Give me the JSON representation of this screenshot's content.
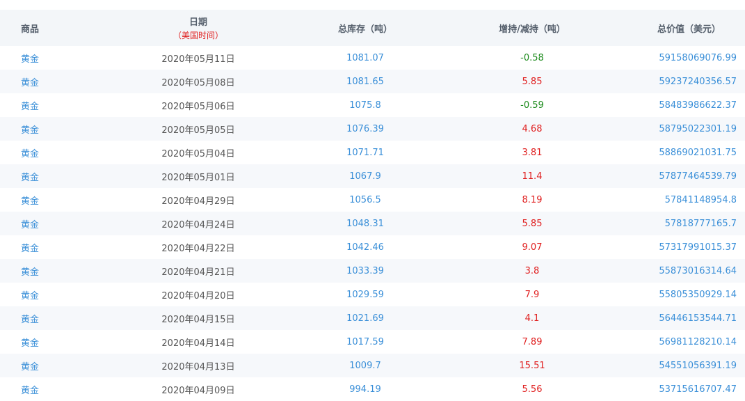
{
  "header": {
    "commodity": "商品",
    "date": "日期",
    "date_note": "（美国时间）",
    "total_holdings": "总库存（吨）",
    "change": "增持/减持（吨）",
    "total_value": "总价值（美元）"
  },
  "colors": {
    "link": "#3a8fd8",
    "increase": "#e02020",
    "decrease": "#1a8a1a"
  },
  "rows": [
    {
      "commodity": "黄金",
      "date": "2020年05月11日",
      "total": "1081.07",
      "change": "-0.58",
      "value": "59158069076.99"
    },
    {
      "commodity": "黄金",
      "date": "2020年05月08日",
      "total": "1081.65",
      "change": "5.85",
      "value": "59237240356.57"
    },
    {
      "commodity": "黄金",
      "date": "2020年05月06日",
      "total": "1075.8",
      "change": "-0.59",
      "value": "58483986622.37"
    },
    {
      "commodity": "黄金",
      "date": "2020年05月05日",
      "total": "1076.39",
      "change": "4.68",
      "value": "58795022301.19"
    },
    {
      "commodity": "黄金",
      "date": "2020年05月04日",
      "total": "1071.71",
      "change": "3.81",
      "value": "58869021031.75"
    },
    {
      "commodity": "黄金",
      "date": "2020年05月01日",
      "total": "1067.9",
      "change": "11.4",
      "value": "57877464539.79"
    },
    {
      "commodity": "黄金",
      "date": "2020年04月29日",
      "total": "1056.5",
      "change": "8.19",
      "value": "57841148954.8"
    },
    {
      "commodity": "黄金",
      "date": "2020年04月24日",
      "total": "1048.31",
      "change": "5.85",
      "value": "57818777165.7"
    },
    {
      "commodity": "黄金",
      "date": "2020年04月22日",
      "total": "1042.46",
      "change": "9.07",
      "value": "57317991015.37"
    },
    {
      "commodity": "黄金",
      "date": "2020年04月21日",
      "total": "1033.39",
      "change": "3.8",
      "value": "55873016314.64"
    },
    {
      "commodity": "黄金",
      "date": "2020年04月20日",
      "total": "1029.59",
      "change": "7.9",
      "value": "55805350929.14"
    },
    {
      "commodity": "黄金",
      "date": "2020年04月15日",
      "total": "1021.69",
      "change": "4.1",
      "value": "56446153544.71"
    },
    {
      "commodity": "黄金",
      "date": "2020年04月14日",
      "total": "1017.59",
      "change": "7.89",
      "value": "56981128210.14"
    },
    {
      "commodity": "黄金",
      "date": "2020年04月13日",
      "total": "1009.7",
      "change": "15.51",
      "value": "54551056391.19"
    },
    {
      "commodity": "黄金",
      "date": "2020年04月09日",
      "total": "994.19",
      "change": "5.56",
      "value": "53715616707.47"
    }
  ]
}
